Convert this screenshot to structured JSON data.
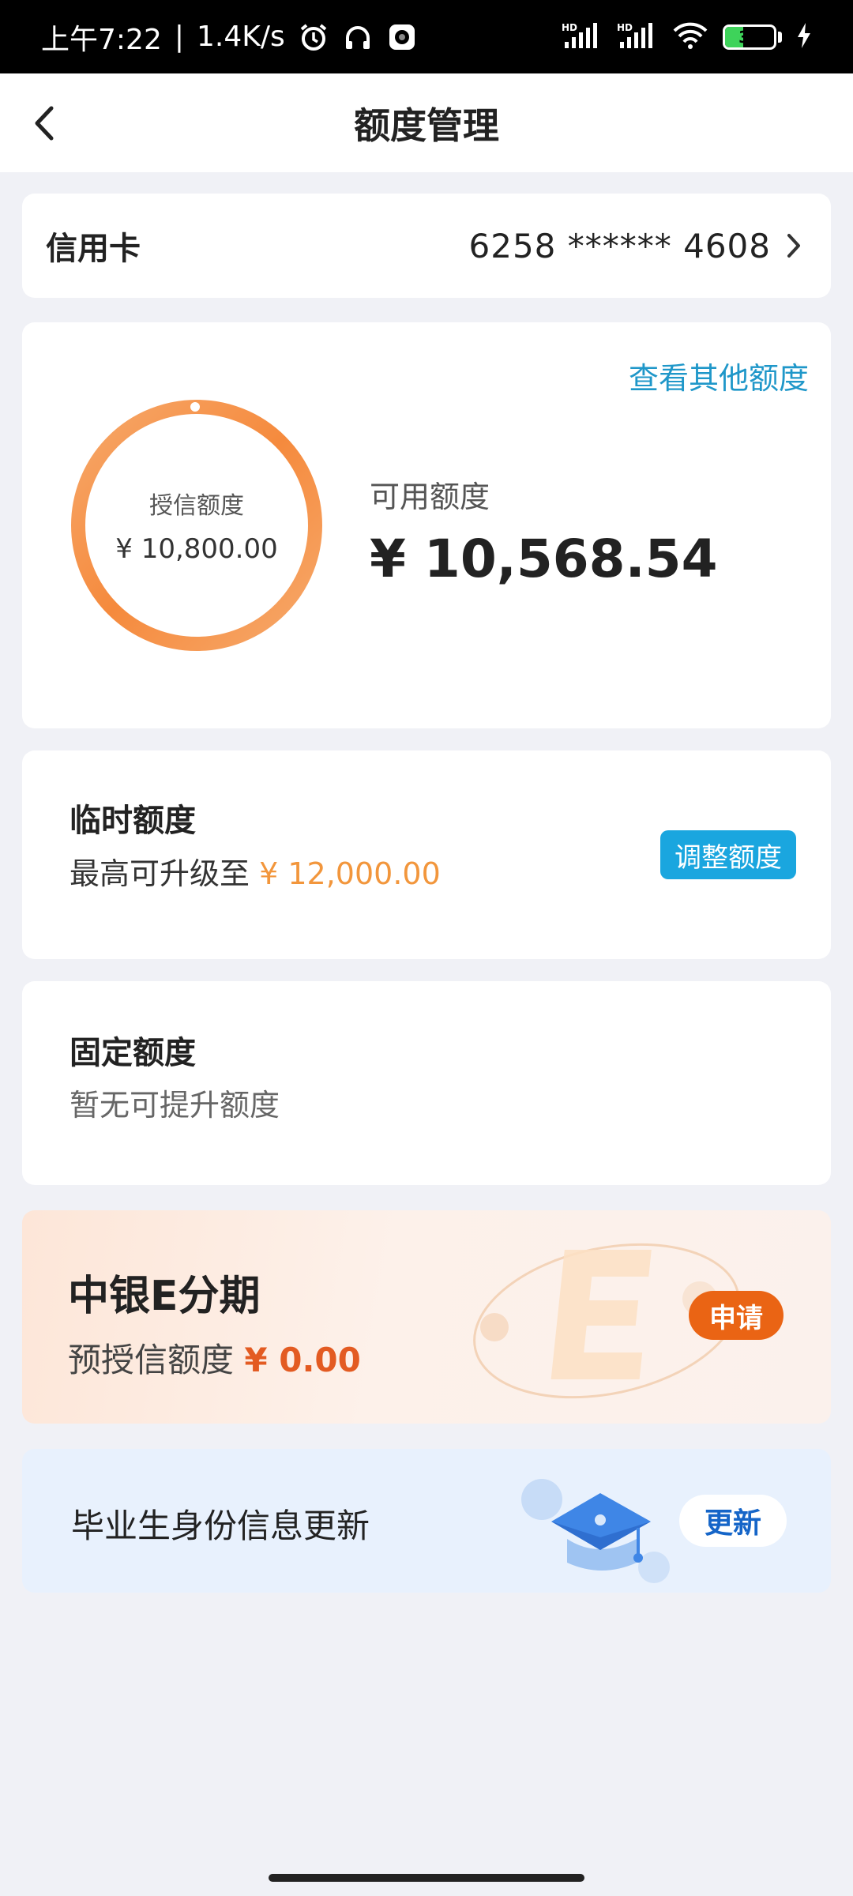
{
  "status_bar": {
    "time": "上午7:22",
    "net_speed": "1.4K/s",
    "signal1": "HD",
    "signal2": "HD",
    "battery": "37",
    "battery_level": 0.37
  },
  "header": {
    "title": "额度管理"
  },
  "card_row": {
    "label": "信用卡",
    "number": "6258 ****** 4608"
  },
  "limit": {
    "other_link": "查看其他额度",
    "credit_label": "授信额度",
    "credit_value": "¥ 10,800.00",
    "available_label": "可用额度",
    "available_value": "¥ 10,568.54",
    "ring_color": "#f5883a"
  },
  "temp_limit": {
    "title": "临时额度",
    "desc": "最高可升级至",
    "amount": "¥ 12,000.00",
    "button": "调整额度"
  },
  "fixed_limit": {
    "title": "固定额度",
    "desc": "暂无可提升额度"
  },
  "e_installment": {
    "title": "中银E分期",
    "desc": "预授信额度",
    "amount": "¥ 0.00",
    "button": "申请"
  },
  "graduate": {
    "title": "毕业生身份信息更新",
    "button": "更新"
  }
}
